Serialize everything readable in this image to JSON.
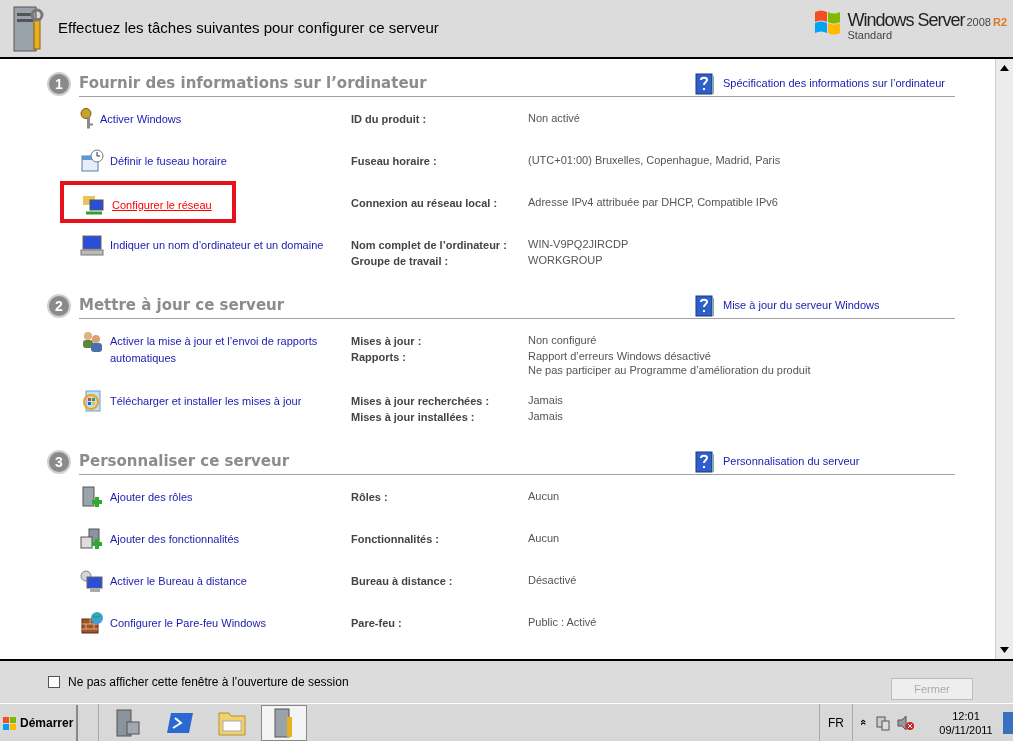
{
  "header": {
    "title": "Effectuez les tâches suivantes pour configurer ce serveur",
    "brand": "Windows Server",
    "version": "2008",
    "release": "R2",
    "edition": "Standard"
  },
  "sections": [
    {
      "number": "1",
      "title": "Fournir des informations sur l’ordinateur",
      "help_link": "Spécification des informations sur l’ordinateur",
      "tasks": [
        {
          "link": "Activer Windows",
          "highlighted": false,
          "details": [
            {
              "label": "ID du produit :",
              "value": [
                "Non activé"
              ]
            }
          ]
        },
        {
          "link": "Définir le fuseau horaire",
          "highlighted": false,
          "details": [
            {
              "label": "Fuseau horaire :",
              "value": [
                "(UTC+01:00) Bruxelles, Copenhague, Madrid, Paris"
              ]
            }
          ]
        },
        {
          "link": "Configurer le réseau",
          "highlighted": true,
          "details": [
            {
              "label": "Connexion au réseau local :",
              "value": [
                "Adresse IPv4 attribuée par DHCP, Compatible IPv6"
              ]
            }
          ]
        },
        {
          "link": "Indiquer un nom d’ordinateur et un domaine",
          "highlighted": false,
          "details": [
            {
              "label": "Nom complet de l’ordinateur :",
              "value": [
                "WIN-V9PQ2JIRCDP"
              ]
            },
            {
              "label": "Groupe de travail :",
              "value": [
                "WORKGROUP"
              ]
            }
          ]
        }
      ]
    },
    {
      "number": "2",
      "title": "Mettre à jour ce serveur",
      "help_link": "Mise à jour du serveur Windows",
      "tasks": [
        {
          "link": "Activer la mise à jour et l’envoi de rapports automatiques",
          "highlighted": false,
          "details": [
            {
              "label": "Mises à jour :",
              "value": [
                "Non configuré"
              ]
            },
            {
              "label": "Rapports :",
              "value": [
                "Rapport d’erreurs Windows désactivé",
                "Ne pas participer au Programme d’amélioration du produit"
              ]
            }
          ]
        },
        {
          "link": "Télécharger et installer les mises à jour",
          "highlighted": false,
          "details": [
            {
              "label": "Mises à jour recherchées :",
              "value": [
                "Jamais"
              ]
            },
            {
              "label": "Mises à jour installées :",
              "value": [
                "Jamais"
              ]
            }
          ]
        }
      ]
    },
    {
      "number": "3",
      "title": "Personnaliser ce serveur",
      "help_link": "Personnalisation du serveur",
      "tasks": [
        {
          "link": "Ajouter des rôles",
          "highlighted": false,
          "details": [
            {
              "label": "Rôles :",
              "value": [
                "Aucun"
              ]
            }
          ]
        },
        {
          "link": "Ajouter des fonctionnalités",
          "highlighted": false,
          "details": [
            {
              "label": "Fonctionnalités :",
              "value": [
                "Aucun"
              ]
            }
          ]
        },
        {
          "link": "Activer le Bureau à distance",
          "highlighted": false,
          "details": [
            {
              "label": "Bureau à distance :",
              "value": [
                "Désactivé"
              ]
            }
          ]
        },
        {
          "link": "Configurer le Pare-feu Windows",
          "highlighted": false,
          "details": [
            {
              "label": "Pare-feu :",
              "value": [
                "Public : Activé"
              ]
            }
          ]
        }
      ]
    }
  ],
  "footer": {
    "checkbox": {
      "label": "Ne pas afficher cette fenêtre à l’ouverture de session",
      "checked": false
    },
    "close_button": {
      "label": "Fermer",
      "disabled": true
    }
  },
  "taskbar": {
    "start": "Démarrer",
    "apps": [
      {
        "selected": false
      },
      {
        "selected": false
      },
      {
        "selected": false
      },
      {
        "selected": true
      }
    ],
    "language": "FR",
    "tray_toggle": "«",
    "time": "12:01",
    "date": "09/11/2011"
  }
}
